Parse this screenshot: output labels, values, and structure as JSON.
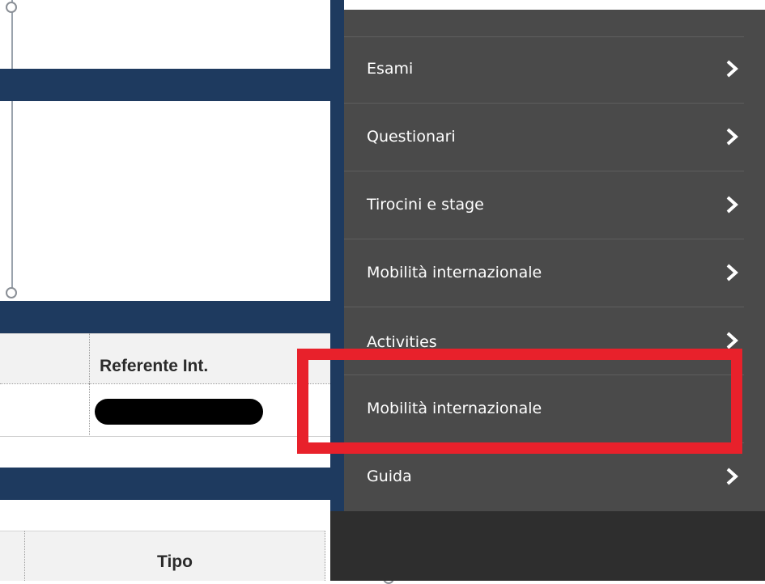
{
  "table": {
    "referente_header": "Referente Int.",
    "tipo_header": "Tipo"
  },
  "menu": {
    "items": [
      {
        "label": "Esami",
        "has_submenu": true
      },
      {
        "label": "Questionari",
        "has_submenu": true
      },
      {
        "label": "Tirocini e stage",
        "has_submenu": true
      },
      {
        "label": "Mobilità internazionale",
        "has_submenu": true
      },
      {
        "label": "Activities",
        "has_submenu": true
      },
      {
        "label": "Mobilità internazionale",
        "has_submenu": false
      },
      {
        "label": "Guida",
        "has_submenu": true
      }
    ],
    "chevron_icon": "chevron-right-icon"
  },
  "colors": {
    "navy": "#1e3a5f",
    "menu_bg": "#4a4a4a",
    "highlight": "#e8212b"
  }
}
